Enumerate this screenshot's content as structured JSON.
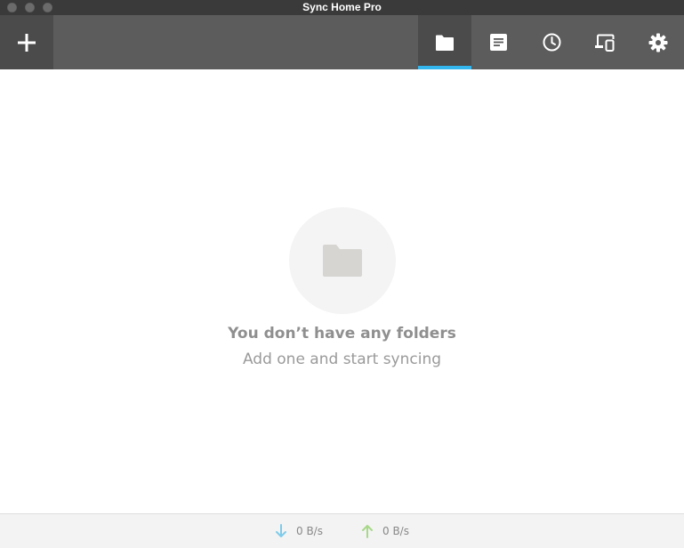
{
  "window": {
    "title": "Sync Home Pro"
  },
  "toolbar": {
    "add_icon": "plus-icon",
    "tabs": [
      {
        "id": "folders",
        "icon": "folder-icon",
        "active": true
      },
      {
        "id": "transfers",
        "icon": "document-icon",
        "active": false
      },
      {
        "id": "history",
        "icon": "clock-icon",
        "active": false
      },
      {
        "id": "devices",
        "icon": "devices-icon",
        "active": false
      },
      {
        "id": "settings",
        "icon": "gear-icon",
        "active": false
      }
    ]
  },
  "colors": {
    "titlebar": "#3a3a3a",
    "toolbar": "#5c5c5c",
    "active_tab": "#4b4b4b",
    "accent": "#33b6ee",
    "download_arrow": "#7ecbea",
    "upload_arrow": "#a8d88a"
  },
  "empty_state": {
    "icon": "folder-icon",
    "title": "You don’t have any folders",
    "subtitle": "Add one and start syncing"
  },
  "status": {
    "download": {
      "icon": "arrow-down-icon",
      "rate": "0 B/s"
    },
    "upload": {
      "icon": "arrow-up-icon",
      "rate": "0 B/s"
    }
  }
}
